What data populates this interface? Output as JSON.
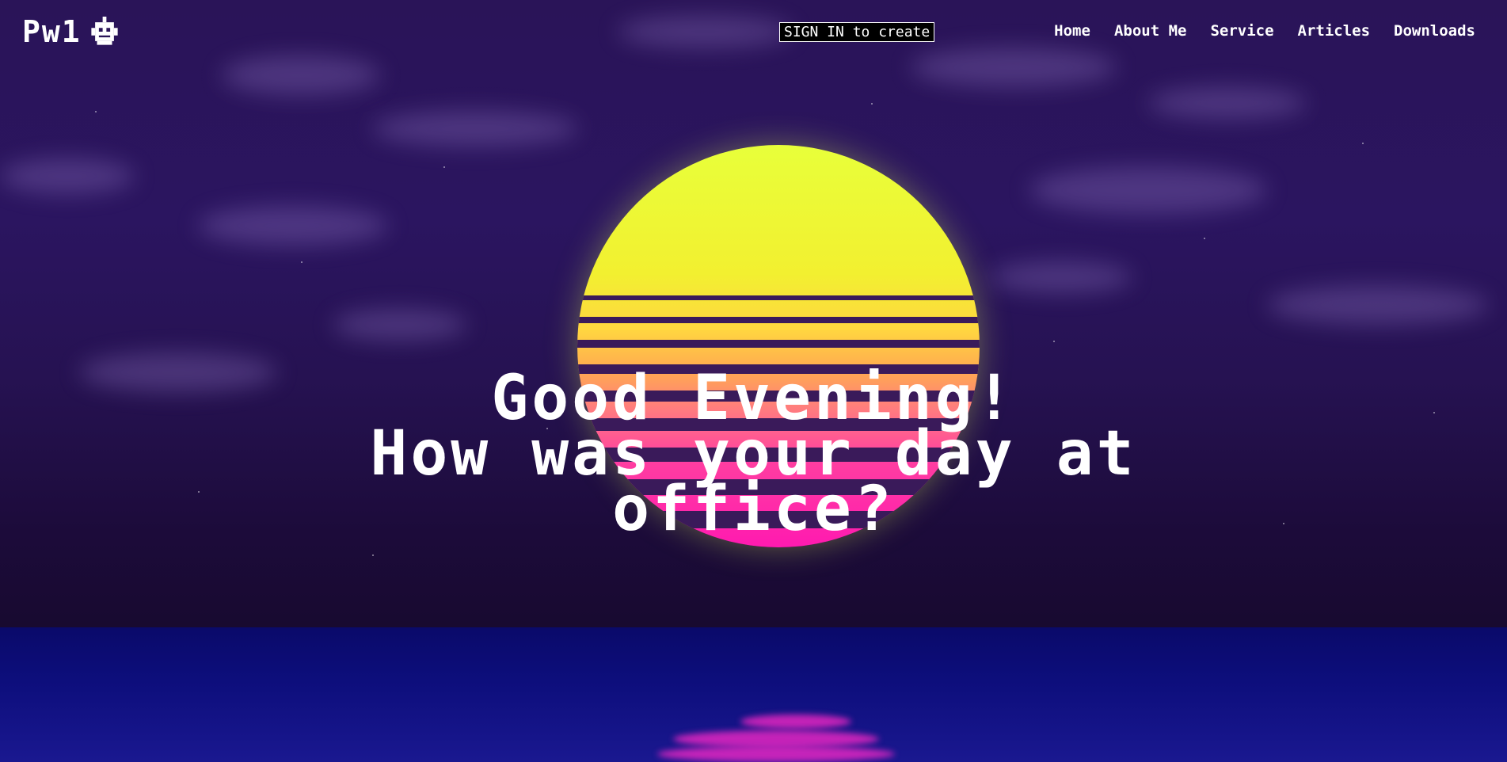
{
  "navbar": {
    "logo_text": "Pw1",
    "logo_icon": "robot-icon",
    "signin_label": "SIGN IN to create",
    "links": [
      {
        "label": "Home"
      },
      {
        "label": "About Me"
      },
      {
        "label": "Service"
      },
      {
        "label": "Articles"
      },
      {
        "label": "Downloads"
      }
    ]
  },
  "hero": {
    "line1": "Good Evening!",
    "line2": "How was your day at",
    "line3": "office?"
  },
  "colors": {
    "sky": "#2a1458",
    "sun_top": "#e8ff3a",
    "sun_bottom": "#ff1ab0",
    "sea": "#0d0e7c",
    "text": "#ffffff"
  }
}
